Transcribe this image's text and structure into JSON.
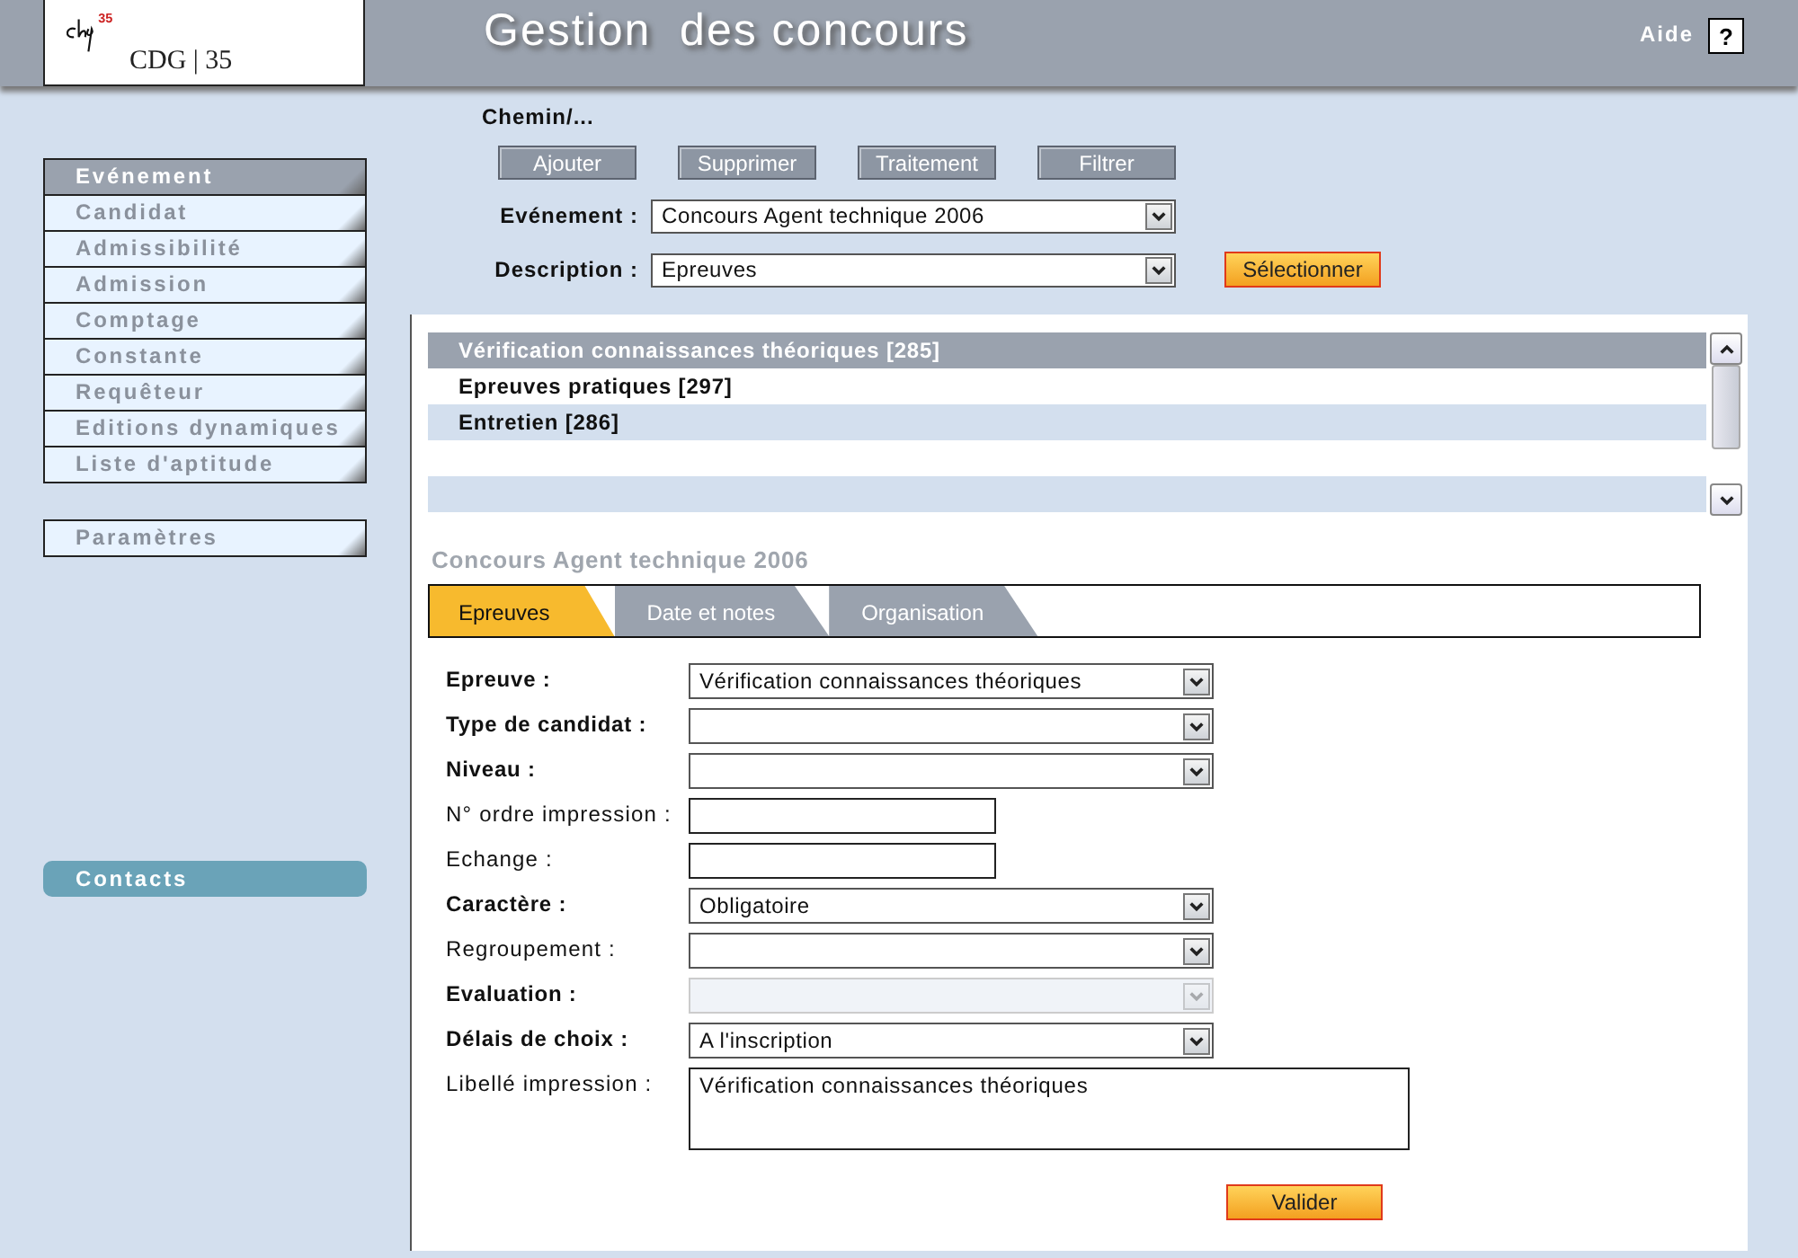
{
  "header": {
    "logo_mark": "35",
    "logo_text": "CDG | 35",
    "title": "Gestion  des concours",
    "help_label": "Aide",
    "help_button": "?"
  },
  "sidebar": {
    "groups": [
      [
        {
          "label": "Evénement",
          "selected": true
        },
        {
          "label": "Candidat",
          "selected": false
        },
        {
          "label": "Admissibilité",
          "selected": false
        },
        {
          "label": "Admission",
          "selected": false
        },
        {
          "label": "Comptage",
          "selected": false
        },
        {
          "label": "Constante",
          "selected": false
        },
        {
          "label": "Requêteur",
          "selected": false
        },
        {
          "label": "Editions dynamiques",
          "selected": false
        },
        {
          "label": "Liste d'aptitude",
          "selected": false
        }
      ],
      [
        {
          "label": "Paramètres",
          "selected": false
        }
      ]
    ],
    "contacts": "Contacts"
  },
  "breadcrumb": "Chemin/...",
  "toolbar": [
    "Ajouter",
    "Supprimer",
    "Traitement",
    "Filtrer"
  ],
  "filters": [
    {
      "label": "Evénement :",
      "value": "Concours Agent technique 2006"
    },
    {
      "label": "Description :",
      "value": "Epreuves"
    }
  ],
  "select_button": "Sélectionner",
  "list": [
    {
      "text": "Vérification connaissances théoriques [285]",
      "selected": true
    },
    {
      "text": "Epreuves pratiques [297]",
      "selected": false
    },
    {
      "text": "Entretien [286]",
      "selected": false
    }
  ],
  "section_title": "Concours Agent technique 2006",
  "tabs": [
    {
      "label": "Epreuves",
      "selected": true
    },
    {
      "label": "Date et notes",
      "selected": false
    },
    {
      "label": "Organisation",
      "selected": false
    }
  ],
  "form": [
    {
      "kind": "select",
      "label": "Epreuve :",
      "required": true,
      "value": "Vérification connaissances théoriques",
      "disabled": false
    },
    {
      "kind": "select",
      "label": "Type de candidat :",
      "required": true,
      "disabled": false
    },
    {
      "kind": "select",
      "label": "Niveau :",
      "required": true,
      "disabled": false
    },
    {
      "kind": "input",
      "label": "N° ordre impression :",
      "required": false
    },
    {
      "kind": "input",
      "label": "Echange :",
      "required": false
    },
    {
      "kind": "select",
      "label": "Caractère :",
      "required": true,
      "value": "Obligatoire",
      "disabled": false
    },
    {
      "kind": "select",
      "label": "Regroupement :",
      "required": false,
      "disabled": false
    },
    {
      "kind": "select",
      "label": "Evaluation :",
      "required": true,
      "disabled": true
    },
    {
      "kind": "select",
      "label": "Délais de choix :",
      "required": true,
      "value": "A l'inscription",
      "disabled": false
    },
    {
      "kind": "textarea",
      "label": "Libellé impression :",
      "required": false,
      "value": "Vérification connaissances théoriques"
    }
  ],
  "submit": "Valider"
}
